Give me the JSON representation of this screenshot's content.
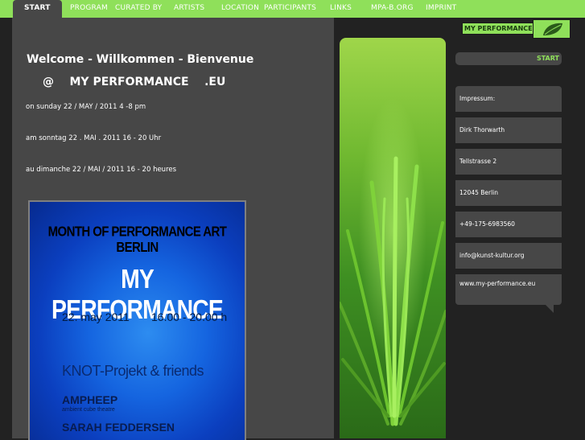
{
  "nav": {
    "items": [
      {
        "label": "START",
        "active": true
      },
      {
        "label": "PROGRAM"
      },
      {
        "label": "CURATED BY"
      },
      {
        "label": "ARTISTS"
      },
      {
        "label": "LOCATION"
      },
      {
        "label": "PARTICIPANTS"
      },
      {
        "label": "LINKS"
      },
      {
        "label": "MPA-B.ORG"
      },
      {
        "label": "IMPRINT"
      }
    ]
  },
  "main": {
    "heading": "Welcome  -  Willkommen  -  Bienvenue",
    "subheading": "@    MY PERFORMANCE    .EU",
    "line1": "on sunday 22 / MAY / 2011 4 -8 pm",
    "line2": "am sonntag 22 . MAI . 2011 16 - 20 Uhr",
    "line3": "au dimanche 22 / MAI / 2011 16 - 20 heures"
  },
  "poster": {
    "title": "MONTH OF PERFORMANCE ART BERLIN",
    "main": "MY PERFORMANCE",
    "date": "22. may 2011       16.00 - 20.00 h",
    "knot": "KNOT-Projekt & friends",
    "ampheep": "AMPHEEP",
    "sub": "ambient cube theatre",
    "sarah": "SARAH FEDDERSEN"
  },
  "sidebar": {
    "logo_text": "MY PERFORMANCE",
    "start_label": "START",
    "imprint": [
      "Impressum:",
      "Dirk Thorwarth",
      "Tellstrasse 2",
      "12045 Berlin",
      "+49-175-6983560",
      "info@kunst-kultur.org",
      "www.my-performance.eu"
    ]
  },
  "colors": {
    "accent": "#8fe05a",
    "panel": "#474747",
    "background": "#222222"
  }
}
